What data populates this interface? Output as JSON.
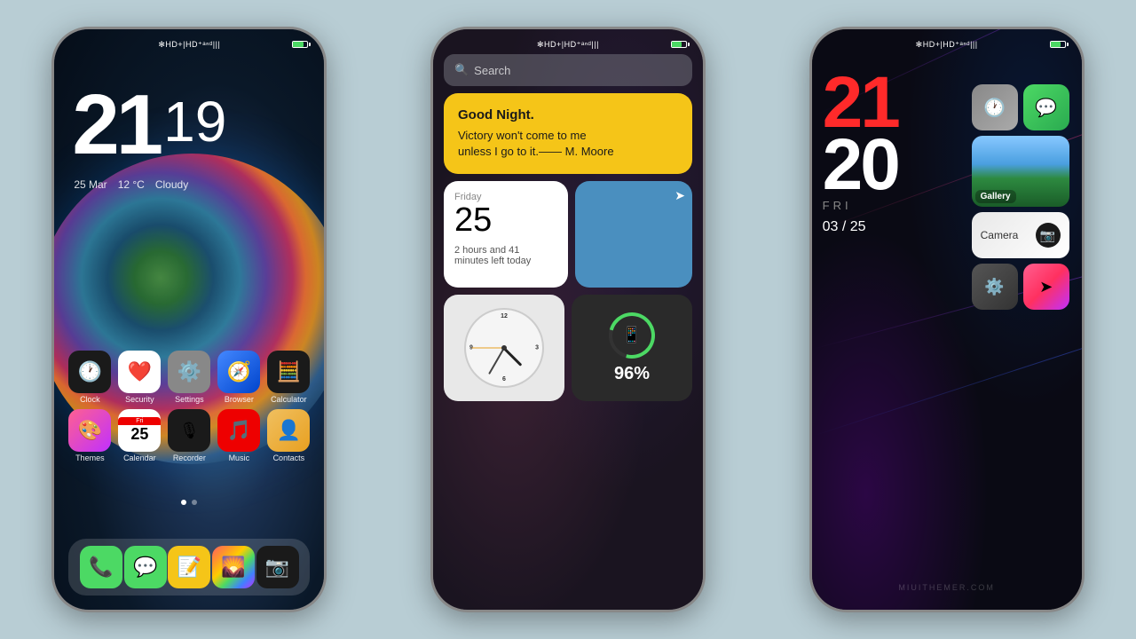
{
  "phones": [
    {
      "id": "phone1",
      "statusBar": "✻HD+|HD⁺ᵃⁿᵈ|||",
      "time": {
        "hour": "21",
        "minute": "19"
      },
      "date": {
        "day": "25 Mar",
        "temp": "12 °C",
        "weather": "Cloudy"
      },
      "apps_row1": [
        {
          "name": "Clock",
          "bg": "bg-clock",
          "icon": "🕐"
        },
        {
          "name": "Security",
          "bg": "bg-health",
          "icon": "❤"
        },
        {
          "name": "Settings",
          "bg": "bg-settings",
          "icon": "⚙"
        },
        {
          "name": "Browser",
          "bg": "bg-safari",
          "icon": "🧭"
        },
        {
          "name": "Calculator",
          "bg": "bg-calc",
          "icon": "🧮"
        }
      ],
      "apps_row2": [
        {
          "name": "Themes",
          "bg": "bg-themes",
          "icon": "🎨"
        },
        {
          "name": "Calendar",
          "bg": "bg-calendar",
          "icon": "📅",
          "date": "25"
        },
        {
          "name": "Recorder",
          "bg": "bg-recorder",
          "icon": "🎙"
        },
        {
          "name": "Music",
          "bg": "bg-music",
          "icon": "🎵"
        },
        {
          "name": "Contacts",
          "bg": "bg-contacts",
          "icon": "👤"
        }
      ],
      "dock": [
        {
          "name": "Phone",
          "bg": "bg-phone",
          "icon": "📞"
        },
        {
          "name": "Messages",
          "bg": "bg-messages",
          "icon": "💬"
        },
        {
          "name": "Notes",
          "bg": "bg-notes",
          "icon": "📝"
        },
        {
          "name": "Photos",
          "bg": "bg-photos",
          "icon": "🌄"
        },
        {
          "name": "Camera",
          "bg": "bg-camera2",
          "icon": "📷"
        }
      ]
    },
    {
      "id": "phone2",
      "statusBar": "✻HD+|HD⁺ᵃⁿᵈ|||",
      "search": {
        "placeholder": "Search"
      },
      "quote": {
        "title": "Good Night.",
        "text": "Victory won't come to me\nunless I go to it.—— M. Moore"
      },
      "calendar": {
        "dayLabel": "Friday",
        "date": "25",
        "timeLeft": "2 hours and 41\nminutes left today"
      },
      "battery": {
        "percent": "96%"
      }
    },
    {
      "id": "phone3",
      "statusBar": "✻HD+|HD⁺ᵃⁿᵈ|||",
      "time": {
        "hour": "21",
        "minute": "20",
        "day": "FRI",
        "monthdate": "03 / 25"
      },
      "apps": [
        {
          "name": "Clock",
          "bg": "icon-clock-bg",
          "icon": "🕐"
        },
        {
          "name": "Chat",
          "bg": "icon-chat-bg",
          "icon": "💬"
        },
        {
          "name": "Gallery",
          "label": "Gallery",
          "icon": "gallery"
        },
        {
          "name": "Camera",
          "label": "Camera",
          "icon": "📷"
        },
        {
          "name": "Settings",
          "bg": "icon-settings-bg",
          "icon": "⚙"
        },
        {
          "name": "Themes",
          "bg": "icon-themes-bg",
          "icon": "➤"
        }
      ],
      "watermark": "MIUITHEMER.COM"
    }
  ]
}
